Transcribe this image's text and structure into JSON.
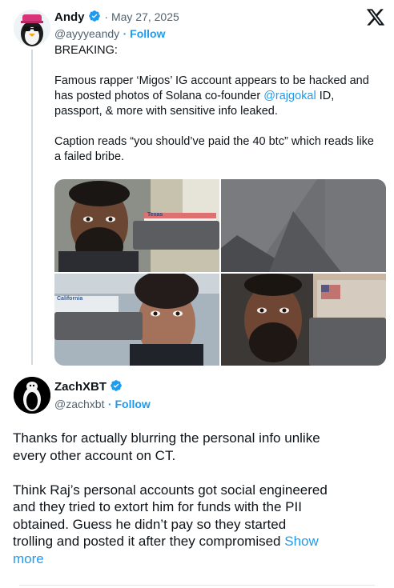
{
  "quoted_post": {
    "author_name": "Andy",
    "date": "· May 27, 2025",
    "handle": "@ayyyeandy",
    "follow_label": "· Follow",
    "lines": {
      "breaking": "BREAKING:",
      "p1a": "Famous rapper ‘Migos’ IG account appears to be hacked and",
      "p1b": "has posted photos of Solana co-founder ",
      "mention": "@rajgokal",
      "p1c": " ID,",
      "p1d": "passport, & more with sensitive info leaked.",
      "p2a": "Caption reads “you should’ve paid the 40 btc” which reads like",
      "p2b": "a failed bribe."
    },
    "photo_labels": {
      "texas": "Texas",
      "california": "California"
    }
  },
  "reply_post": {
    "author_name": "ZachXBT",
    "handle": "@zachxbt",
    "follow_label": "· Follow",
    "lines": {
      "l1": "Thanks for actually blurring the personal info unlike",
      "l2": "every other account on CT.",
      "l3": "Think Raj’s personal accounts got social engineered",
      "l4": "and they tried to extort him for funds with the PII",
      "l5": "obtained. Guess he didn’t pay so they started",
      "l6": "trolling and posted it after they compromised ",
      "show_more_1": "Show",
      "show_more_2": "more"
    }
  },
  "icons": {
    "platform_logo": "x-logo-icon",
    "verified": "verified-badge-icon"
  },
  "colors": {
    "accent": "#1d9bf0",
    "text": "#0f1419",
    "secondary": "#536471"
  }
}
